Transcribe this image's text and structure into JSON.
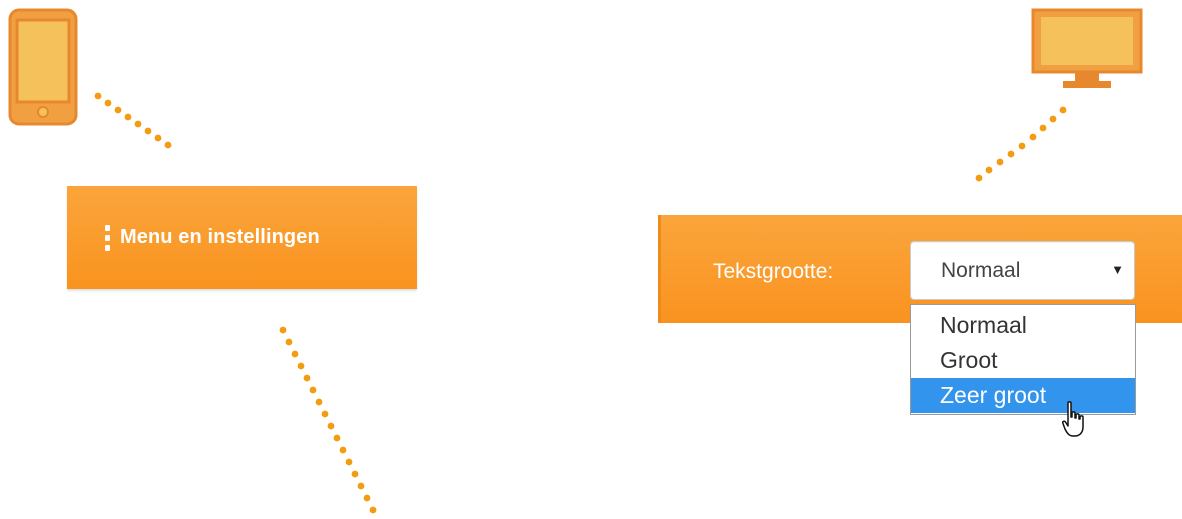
{
  "mobile": {
    "menu_label": "Menu en instellingen"
  },
  "desktop": {
    "text_size_label": "Tekstgrootte:",
    "select_value": "Normaal",
    "select_caret": "▼",
    "options": [
      {
        "label": "Normaal",
        "highlighted": false
      },
      {
        "label": "Groot",
        "highlighted": false
      },
      {
        "label": "Zeer groot",
        "highlighted": true
      }
    ]
  },
  "colors": {
    "bar_orange": "#f9931f",
    "icon_fill": "#f5c15a",
    "icon_stroke": "#e8882e",
    "dots": "#f39c12",
    "highlight_blue": "#3294ec"
  },
  "icons": {
    "phone": "smartphone-icon",
    "monitor": "desktop-monitor-icon",
    "menu": "kebab-menu-icon",
    "cursor": "mouse-pointer-icon"
  }
}
